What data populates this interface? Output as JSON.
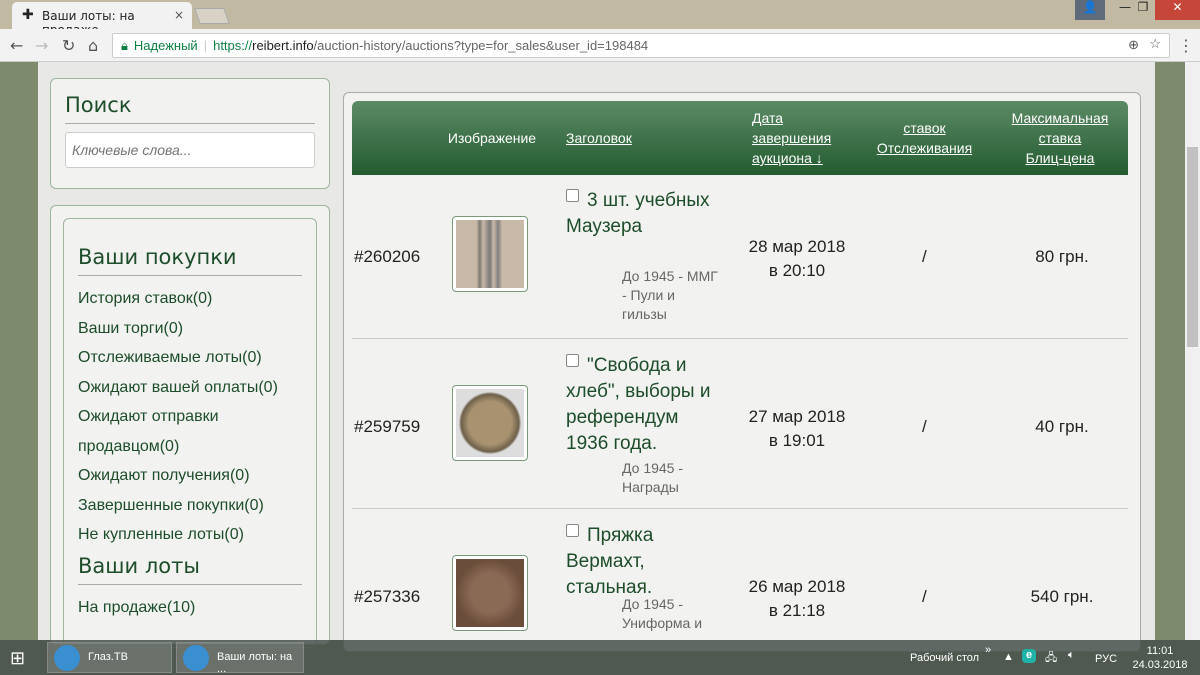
{
  "browser": {
    "tab_title": "Ваши лоты: на продаже",
    "secure_label": "Надежный",
    "url_scheme": "https://",
    "url_host": "reibert.info",
    "url_path": "/auction-history/auctions?type=for_sales&user_id=198484"
  },
  "search": {
    "title": "Поиск",
    "placeholder": "Ключевые слова..."
  },
  "purchases": {
    "title": "Ваши покупки",
    "items": [
      "История ставок(0)",
      "Ваши торги(0)",
      "Отслеживаемые лоты(0)",
      "Ожидают вашей оплаты(0)",
      "Ожидают отправки продавцом(0)",
      "Ожидают получения(0)",
      "Завершенные покупки(0)",
      "Не купленные лоты(0)"
    ]
  },
  "lots": {
    "title": "Ваши лоты",
    "items": [
      "На продаже(10)"
    ]
  },
  "table": {
    "headers": {
      "image": "Изображение",
      "title": "Заголовок",
      "date": "Дата завершения аукциона ↓",
      "bids": "ставок",
      "watch": "Отслеживания",
      "maxbid": "Максимальная ставка",
      "blitz": "Блиц-цена"
    },
    "rows": [
      {
        "id": "#260206",
        "title": "3 шт. учебных Маузера",
        "category": "До 1945 - ММГ - Пули и гильзы",
        "date": "28 мар 2018",
        "time": "в 20:10",
        "bids": "/",
        "price": "80 грн."
      },
      {
        "id": "#259759",
        "title": "\"Свобода и хлеб\", выборы и референдум 1936 года.",
        "category": "До 1945 - Награды",
        "date": "27 мар 2018",
        "time": "в 19:01",
        "bids": "/",
        "price": "40 грн."
      },
      {
        "id": "#257336",
        "title": "Пряжка Вермахт, стальная.",
        "category": "До 1945 - Униформа и",
        "date": "26 мар 2018",
        "time": "в 21:18",
        "bids": "/",
        "price": "540 грн."
      }
    ]
  },
  "taskbar": {
    "apps": [
      "Глаз.ТВ",
      "Ваши лоты: на ..."
    ],
    "desktop": "Рабочий стол",
    "lang": "РУС",
    "time": "11:01",
    "date": "24.03.2018"
  }
}
